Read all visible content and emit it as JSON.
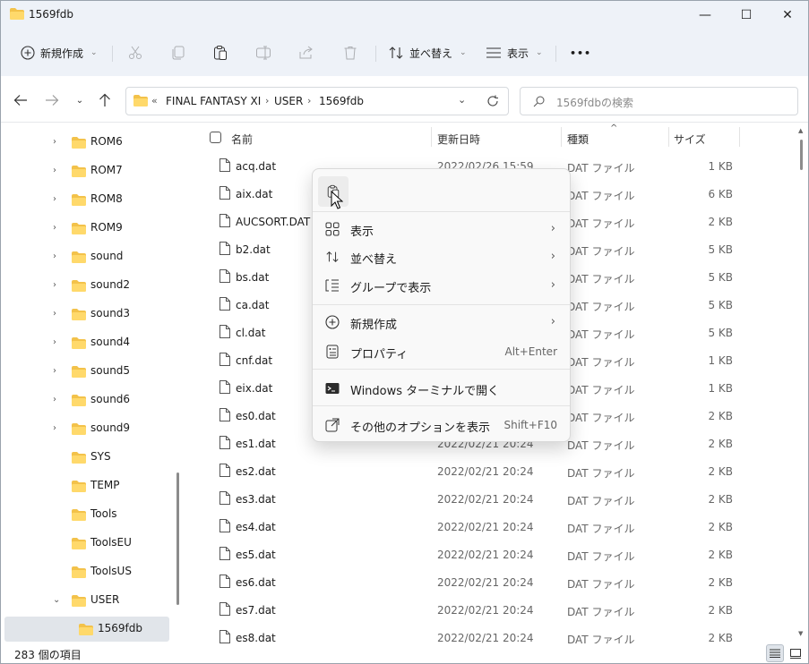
{
  "window": {
    "title": "1569fdb",
    "minimize": "—",
    "maximize": "☐",
    "close": "✕"
  },
  "toolbar": {
    "new_label": "新規作成",
    "sort_label": "並べ替え",
    "view_label": "表示",
    "more_label": "•••"
  },
  "address": {
    "overflow": "«",
    "crumbs": [
      "FINAL FANTASY XI",
      "USER",
      "1569fdb"
    ],
    "separator": "›"
  },
  "search": {
    "placeholder": "1569fdbの検索"
  },
  "nav_tree": [
    {
      "label": "ROM6",
      "chevron": "›"
    },
    {
      "label": "ROM7",
      "chevron": "›"
    },
    {
      "label": "ROM8",
      "chevron": "›"
    },
    {
      "label": "ROM9",
      "chevron": "›"
    },
    {
      "label": "sound",
      "chevron": "›"
    },
    {
      "label": "sound2",
      "chevron": "›"
    },
    {
      "label": "sound3",
      "chevron": "›"
    },
    {
      "label": "sound4",
      "chevron": "›"
    },
    {
      "label": "sound5",
      "chevron": "›"
    },
    {
      "label": "sound6",
      "chevron": "›"
    },
    {
      "label": "sound9",
      "chevron": "›"
    },
    {
      "label": "SYS",
      "chevron": ""
    },
    {
      "label": "TEMP",
      "chevron": ""
    },
    {
      "label": "Tools",
      "chevron": ""
    },
    {
      "label": "ToolsEU",
      "chevron": ""
    },
    {
      "label": "ToolsUS",
      "chevron": ""
    },
    {
      "label": "USER",
      "chevron": "⌄"
    },
    {
      "label": "1569fdb",
      "chevron": ""
    }
  ],
  "columns": {
    "name": "名前",
    "date": "更新日時",
    "type": "種類",
    "size": "サイズ"
  },
  "files": [
    {
      "name": "acq.dat",
      "date": "2022/02/26 15:59",
      "type": "DAT ファイル",
      "size": "1 KB"
    },
    {
      "name": "aix.dat",
      "date": "",
      "type": "DAT ファイル",
      "size": "6 KB"
    },
    {
      "name": "AUCSORT.DAT",
      "date": "",
      "type": "DAT ファイル",
      "size": "2 KB"
    },
    {
      "name": "b2.dat",
      "date": "",
      "type": "DAT ファイル",
      "size": "5 KB"
    },
    {
      "name": "bs.dat",
      "date": "",
      "type": "DAT ファイル",
      "size": "5 KB"
    },
    {
      "name": "ca.dat",
      "date": "",
      "type": "DAT ファイル",
      "size": "5 KB"
    },
    {
      "name": "cl.dat",
      "date": "",
      "type": "DAT ファイル",
      "size": "5 KB"
    },
    {
      "name": "cnf.dat",
      "date": "",
      "type": "DAT ファイル",
      "size": "1 KB"
    },
    {
      "name": "eix.dat",
      "date": "",
      "type": "DAT ファイル",
      "size": "1 KB"
    },
    {
      "name": "es0.dat",
      "date": "",
      "type": "DAT ファイル",
      "size": "2 KB"
    },
    {
      "name": "es1.dat",
      "date": "2022/02/21 20:24",
      "type": "DAT ファイル",
      "size": "2 KB"
    },
    {
      "name": "es2.dat",
      "date": "2022/02/21 20:24",
      "type": "DAT ファイル",
      "size": "2 KB"
    },
    {
      "name": "es3.dat",
      "date": "2022/02/21 20:24",
      "type": "DAT ファイル",
      "size": "2 KB"
    },
    {
      "name": "es4.dat",
      "date": "2022/02/21 20:24",
      "type": "DAT ファイル",
      "size": "2 KB"
    },
    {
      "name": "es5.dat",
      "date": "2022/02/21 20:24",
      "type": "DAT ファイル",
      "size": "2 KB"
    },
    {
      "name": "es6.dat",
      "date": "2022/02/21 20:24",
      "type": "DAT ファイル",
      "size": "2 KB"
    },
    {
      "name": "es7.dat",
      "date": "2022/02/21 20:24",
      "type": "DAT ファイル",
      "size": "2 KB"
    },
    {
      "name": "es8.dat",
      "date": "2022/02/21 20:24",
      "type": "DAT ファイル",
      "size": "2 KB"
    }
  ],
  "context_menu": {
    "view": "表示",
    "sort": "並べ替え",
    "group": "グループで表示",
    "new": "新規作成",
    "properties": "プロパティ",
    "properties_shortcut": "Alt+Enter",
    "terminal": "Windows ターミナルで開く",
    "more_options": "その他のオプションを表示",
    "more_options_shortcut": "Shift+F10",
    "submenu_arrow": "›"
  },
  "status": {
    "item_count": "283 個の項目"
  },
  "colors": {
    "folder": "#f3c24a",
    "accent": "#0067c0"
  }
}
